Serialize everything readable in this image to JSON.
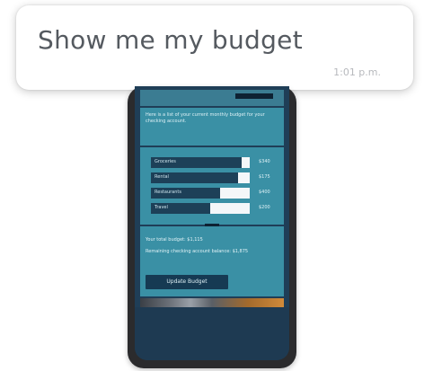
{
  "chat": {
    "message": "Show me my budget",
    "time": "1:01 p.m."
  },
  "phone_screen": {
    "intro_text": "Here is a list of your current monthly budget for your checking account.",
    "budget_rows": [
      {
        "label": "Groceries",
        "amount": "$340",
        "fill": 0.92
      },
      {
        "label": "Rental",
        "amount": "$175",
        "fill": 0.88
      },
      {
        "label": "Restaurants",
        "amount": "$400",
        "fill": 0.7
      },
      {
        "label": "Travel",
        "amount": "$200",
        "fill": 0.6
      }
    ],
    "summary_line1": "Your total budget: $1,115",
    "summary_line2": "Remaining checking account balance: $1,875",
    "update_button": "Update Budget"
  },
  "colors": {
    "screen_bg": "#1f3e57",
    "panel_bg": "#3a90a5",
    "bar_fill": "#1d4058"
  }
}
